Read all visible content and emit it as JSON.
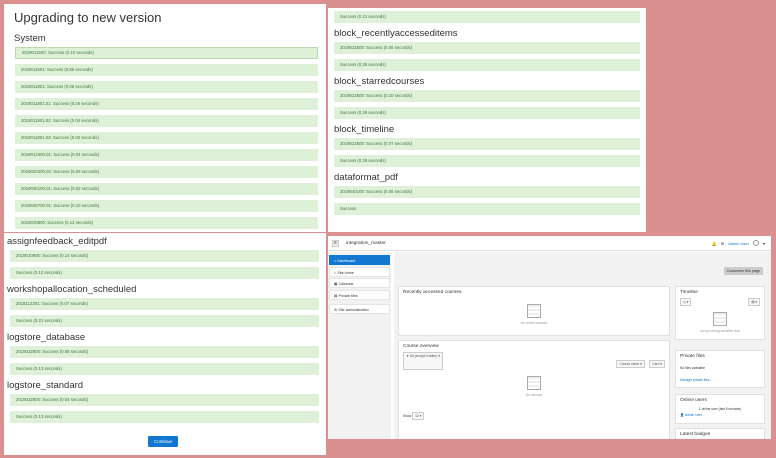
{
  "upgrade": {
    "title": "Upgrading to new version",
    "continue_label": "Continue",
    "panel1": [
      {
        "heading": "System",
        "rows": [
          "2019011500: Success (0.10 seconds)",
          "2019011501: Success (0.86 seconds)",
          "2019011801: Success (0.05 seconds)",
          "2019011801.01: Success (0.06 seconds)",
          "2019011801.02: Success (0.04 seconds)",
          "2019011801.03: Success (0.02 seconds)",
          "2019012300.01: Success (0.04 seconds)",
          "2019020200.02: Success (0.05 seconds)",
          "2019030100.01: Success (0.02 seconds)",
          "2019030700.01: Success (0.10 seconds)",
          "2019030800: Success (0.12 seconds)"
        ]
      }
    ],
    "panel2": [
      {
        "heading": "",
        "rows": [
          "Success (0.21 seconds)"
        ]
      },
      {
        "heading": "block_recentlyaccesseditems",
        "rows": [
          "2019032600: Success (0.06 seconds)",
          "Success (0.25 seconds)"
        ]
      },
      {
        "heading": "block_starredcourses",
        "rows": [
          "2019022600: Success (0.10 seconds)",
          "Success (0.29 seconds)"
        ]
      },
      {
        "heading": "block_timeline",
        "rows": [
          "2019022600: Success (0.07 seconds)",
          "Success (0.28 seconds)"
        ]
      },
      {
        "heading": "dataformat_pdf",
        "rows": [
          "2019040100: Success (0.06 seconds)",
          "Success"
        ]
      }
    ],
    "panel3": [
      {
        "heading": "assignfeedback_editpdf",
        "rows": [
          "2019010800: Success (0.14 seconds)",
          "Success (0.12 seconds)"
        ]
      },
      {
        "heading": "workshopallocation_scheduled",
        "rows": [
          "2018112301: Success (0.07 seconds)",
          "Success (0.21 seconds)"
        ]
      },
      {
        "heading": "logstore_database",
        "rows": [
          "2019032800: Success (0.08 seconds)",
          "Success (0.13 seconds)"
        ]
      },
      {
        "heading": "logstore_standard",
        "rows": [
          "2019032800: Success (0.04 seconds)",
          "Success (0.13 seconds)"
        ]
      }
    ]
  },
  "dashboard": {
    "site_name": "integration_master",
    "user_name": "Admin User",
    "nav": [
      "Dashboard",
      "Site home",
      "Calendar",
      "Private files",
      "Site administration"
    ],
    "customise_label": "Customise this page",
    "recent_title": "Recently accessed courses",
    "recent_empty": "No recent courses",
    "timeline_title": "Timeline",
    "timeline_empty": "No upcoming activities due",
    "course_overview_title": "Course overview",
    "filter_label": "All (except hidden)",
    "sort_label": "Course name",
    "view_label": "Card",
    "courses_empty": "No courses",
    "show_label": "Show",
    "show_value": "12",
    "private_files_title": "Private files",
    "no_files": "No files available",
    "manage_files": "Manage private files...",
    "online_users_title": "Online users",
    "online_count": "1 online user (last 5 minutes)",
    "online_user": "Admin User",
    "latest_badges_title": "Latest badges"
  }
}
